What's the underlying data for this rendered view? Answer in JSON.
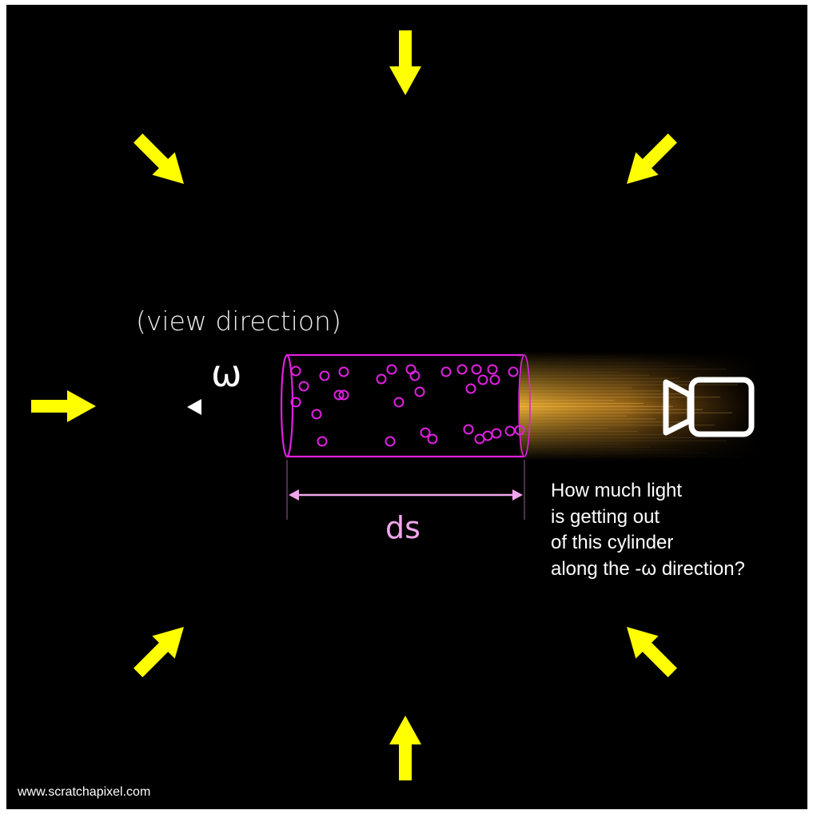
{
  "labels": {
    "view_direction": "(view direction)",
    "omega": "ω",
    "ds": "ds",
    "question_lines": [
      "How much light",
      "is getting out",
      "of this cylinder",
      "along the -ω direction?"
    ],
    "watermark": "www.scratchapixel.com"
  },
  "colors": {
    "background": "#000000",
    "incoming_light_arrows": "#ffff00",
    "cylinder": "#e020e0",
    "particles": "#e020e0",
    "view_ray": "#ffffff",
    "ds_measure": "#f0a6ec",
    "camera_glow": "#f0b030",
    "camera_icon": "#ffffff",
    "text": "#ffffff"
  },
  "icons": {
    "camera": "video-camera-icon",
    "light_arrow": "yellow-arrow-icon"
  }
}
